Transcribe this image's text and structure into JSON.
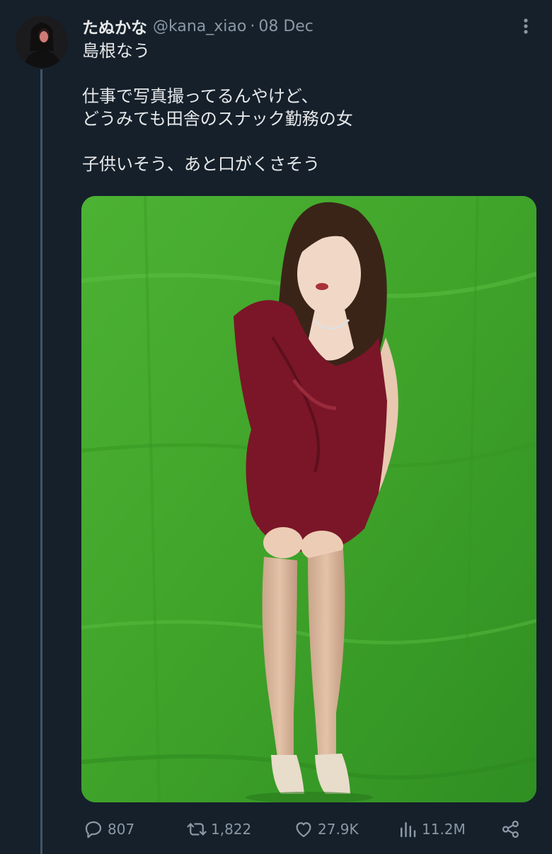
{
  "tweet": {
    "display_name": "たぬかな",
    "handle": "@kana_xiao",
    "separator": "·",
    "date": "08 Dec",
    "lines": [
      "島根なう",
      "",
      "仕事で写真撮ってるんやけど、",
      "どうみても田舎のスナック勤務の女",
      "",
      "子供いそう、あと口がくさそう"
    ]
  },
  "actions": {
    "replies": "807",
    "reposts": "1,822",
    "likes": "27.9K",
    "views": "11.2M"
  },
  "icons": {
    "more": "more-vertical-icon",
    "reply": "reply-icon",
    "repost": "repost-icon",
    "like": "heart-icon",
    "views": "bar-chart-icon",
    "share": "share-icon"
  },
  "colors": {
    "background": "#15202b",
    "text": "#e7e9ea",
    "secondary": "#8b98a5",
    "thread_line": "#425466",
    "green_screen": "#41a52a",
    "dress": "#7a1628"
  }
}
